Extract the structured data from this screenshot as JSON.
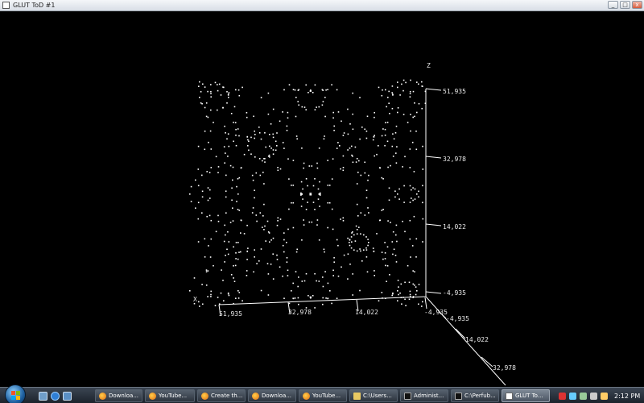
{
  "window": {
    "title": "GLUT ToD #1",
    "buttons": {
      "minimize": "_",
      "maximize": "□",
      "close": "x"
    }
  },
  "scene": {
    "point_color": "#ffffff",
    "axis_color": "#ffffff",
    "axes": {
      "z": {
        "name": "Z",
        "ticks": [
          "51,935",
          "32,978",
          "14,022",
          "-4,935"
        ]
      },
      "x": {
        "name": "X",
        "ticks": [
          "51,935",
          "32,978",
          "14,022",
          "-4,935"
        ]
      },
      "y": {
        "ticks": [
          "-4,935",
          "14,022",
          "32,978"
        ]
      }
    }
  },
  "taskbar": {
    "start": "start-orb",
    "quick_launch": [
      "show-desktop-icon",
      "internet-explorer-icon",
      "switch-windows-icon"
    ],
    "tasks": [
      {
        "label": "Downloa...",
        "icon": "firefox-icon",
        "active": false
      },
      {
        "label": "YouTube...",
        "icon": "firefox-icon",
        "active": false
      },
      {
        "label": "Create th...",
        "icon": "firefox-icon",
        "active": false
      },
      {
        "label": "Downloa...",
        "icon": "firefox-icon",
        "active": false
      },
      {
        "label": "YouTube...",
        "icon": "firefox-icon",
        "active": false
      },
      {
        "label": "C:\\Users...",
        "icon": "folder-icon",
        "active": false
      },
      {
        "label": "Administ...",
        "icon": "cmd-icon",
        "active": false
      },
      {
        "label": "C:\\Perfub...",
        "icon": "cmd-icon",
        "active": false
      },
      {
        "label": "GLUT To...",
        "icon": "glut-icon",
        "active": true
      }
    ],
    "clock": "2:12 PM"
  }
}
